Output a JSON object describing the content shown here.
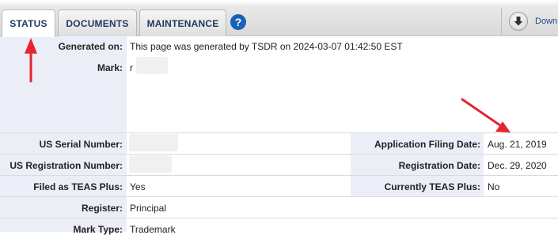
{
  "tabs": [
    {
      "label": "STATUS",
      "active": true
    },
    {
      "label": "DOCUMENTS",
      "active": false
    },
    {
      "label": "MAINTENANCE",
      "active": false
    }
  ],
  "toolbar": {
    "help_label": "?",
    "download_label": "Down"
  },
  "fields": {
    "generated_on": {
      "label": "Generated on:",
      "value": "This page was generated by TSDR on 2024-03-07 01:42:50 EST"
    },
    "mark": {
      "label": "Mark:",
      "value": "r"
    },
    "serial_number": {
      "label": "US Serial Number:"
    },
    "filing_date": {
      "label": "Application Filing Date:",
      "value": "Aug. 21, 2019"
    },
    "registration_number": {
      "label": "US Registration Number:"
    },
    "registration_date": {
      "label": "Registration Date:",
      "value": "Dec. 29, 2020"
    },
    "teas_plus": {
      "label": "Filed as TEAS Plus:",
      "value": "Yes"
    },
    "currently_teas_plus": {
      "label": "Currently TEAS Plus:",
      "value": "No"
    },
    "register": {
      "label": "Register:",
      "value": "Principal"
    },
    "mark_type": {
      "label": "Mark Type:",
      "value": "Trademark"
    }
  },
  "colors": {
    "label_bg": "#eceef7",
    "tab_text": "#203a63",
    "help_bg": "#1a61b8",
    "annotation": "#e3262e"
  },
  "icons": {
    "help": "question-circle-icon",
    "download": "download-arrow-icon"
  }
}
